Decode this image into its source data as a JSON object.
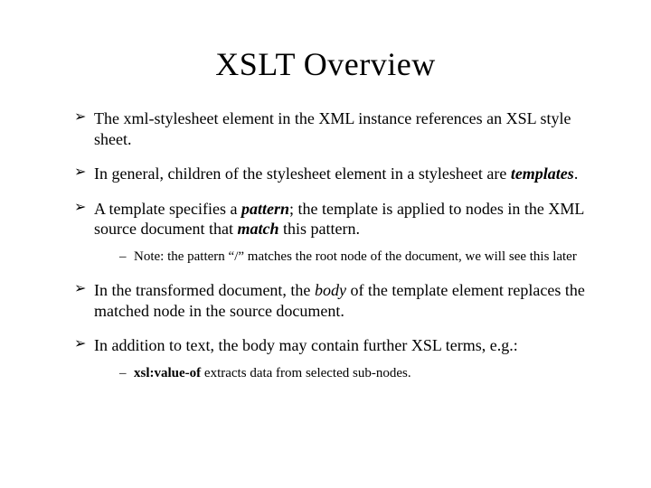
{
  "title": "XSLT Overview",
  "bullets": {
    "b1": {
      "a": "The xml-stylesheet element in the XML instance references an XSL style sheet."
    },
    "b2": {
      "a": "In general, children of the stylesheet element in a stylesheet are ",
      "b": "templates",
      "c": "."
    },
    "b3": {
      "a": "A template specifies a ",
      "b": "pattern",
      "c": "; the template is applied to nodes in the XML source document that ",
      "d": "match",
      "e": " this pattern."
    },
    "b3s1": {
      "a": "Note: the pattern “/” matches the root node of the document, we will see this later"
    },
    "b4": {
      "a": "In the transformed document, the ",
      "b": "body",
      "c": " of the template element replaces the matched node in the source document."
    },
    "b5": {
      "a": "In addition to text, the body may contain further XSL terms, e.g.:"
    },
    "b5s1": {
      "a": "xsl:value-of",
      "b": " extracts data from selected sub-nodes."
    }
  }
}
